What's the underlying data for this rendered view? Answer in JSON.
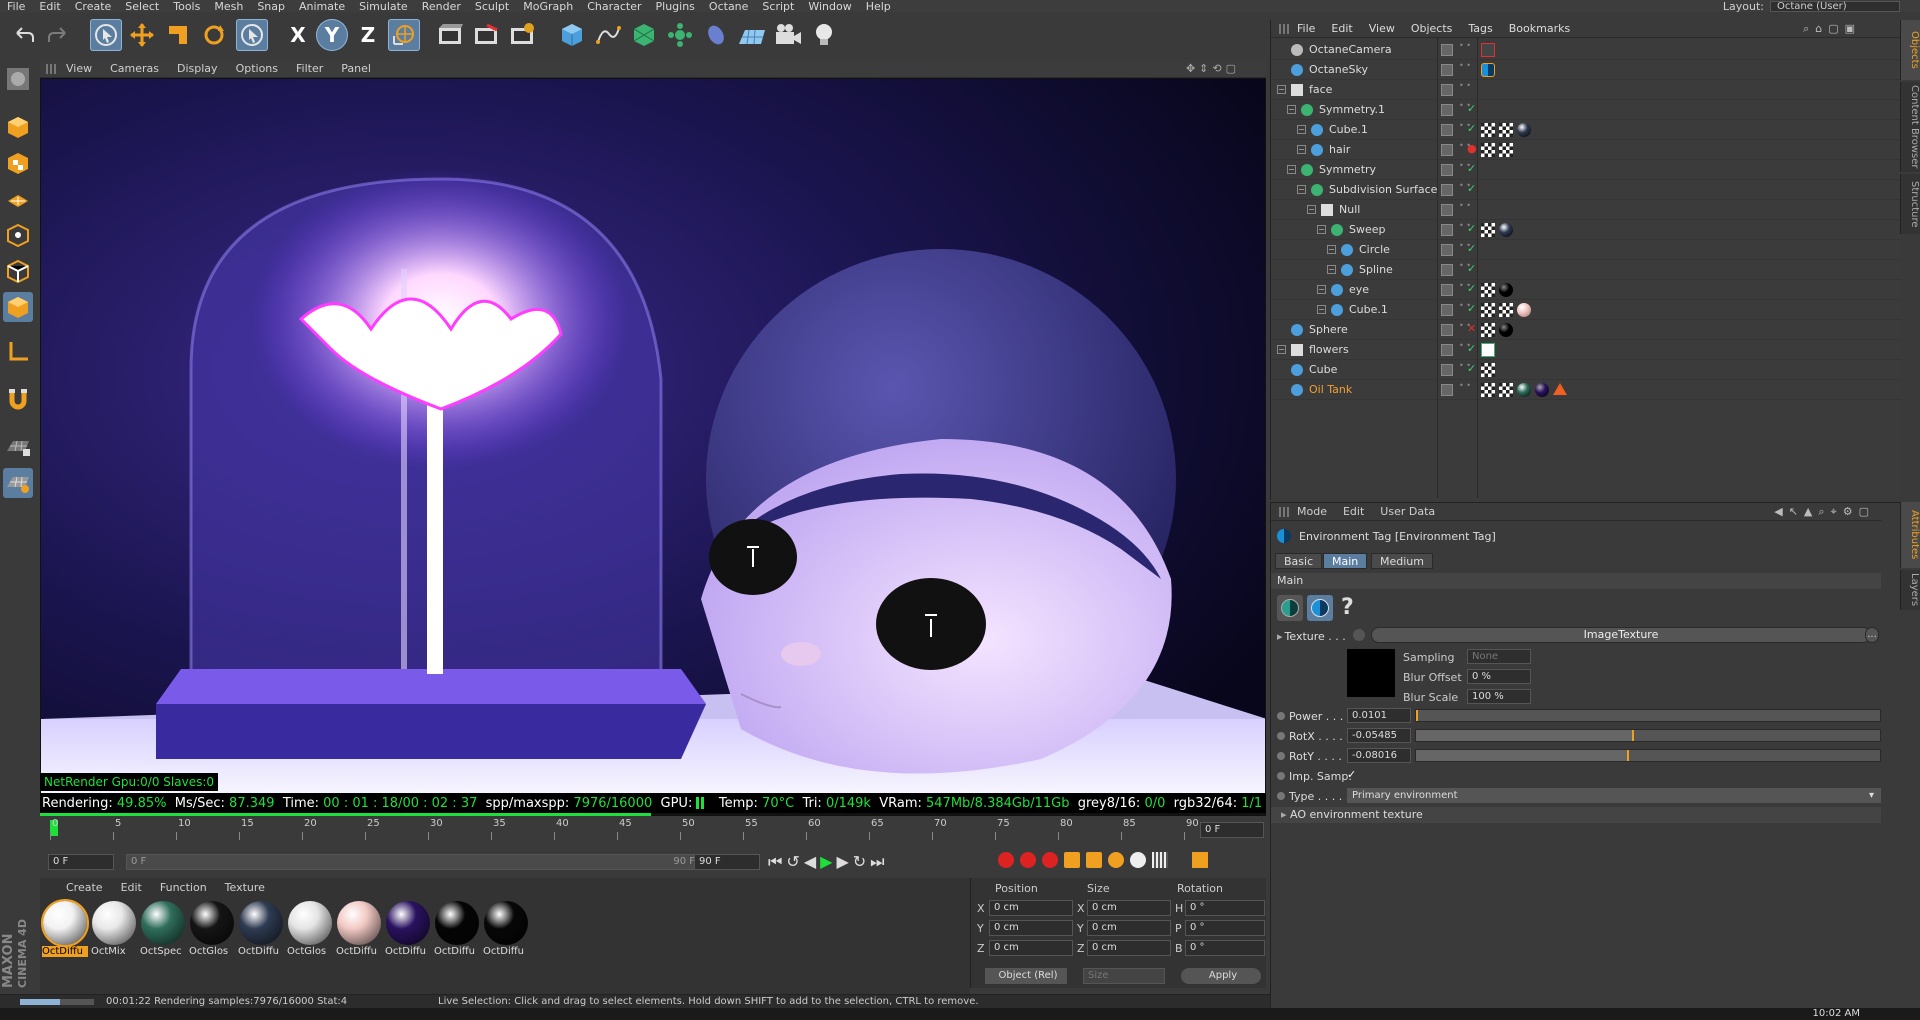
{
  "app": {
    "brand_line1": "MAXON",
    "brand_line2": "CINEMA 4D"
  },
  "menubar": {
    "items": [
      "File",
      "Edit",
      "Create",
      "Select",
      "Tools",
      "Mesh",
      "Snap",
      "Animate",
      "Simulate",
      "Render",
      "Sculpt",
      "MoGraph",
      "Character",
      "Plugins",
      "Octane",
      "Script",
      "Window",
      "Help"
    ],
    "layout_label": "Layout:",
    "layout_value": "Octane (User)"
  },
  "toolbar": {
    "icons": [
      "undo-icon",
      "redo-icon",
      "live-selection-icon",
      "move-icon",
      "scale-icon",
      "rotate-icon",
      "recent-tool-icon",
      "x-axis-icon",
      "y-axis-icon",
      "z-axis-icon",
      "world-coordinates-icon",
      "render-view-icon",
      "render-picture-viewer-icon",
      "render-settings-icon",
      "cube-object-icon",
      "pen-spline-icon",
      "subdivision-icon",
      "array-icon",
      "deformer-icon",
      "floor-icon",
      "camera-icon",
      "light-icon"
    ],
    "axis_x": "X",
    "axis_y": "Y",
    "axis_z": "Z"
  },
  "viewport_menu": {
    "items": [
      "View",
      "Cameras",
      "Display",
      "Options",
      "Filter",
      "Panel"
    ]
  },
  "render_status": {
    "netrender": "NetRender Gpu:0/0 Slaves:0",
    "rendering_label": "Rendering:",
    "rendering_value": "49.85%",
    "ms_label": "Ms/Sec:",
    "ms_value": "87.349",
    "time_label": "Time:",
    "time_value": "00 : 01 : 18/00 : 02 : 37",
    "spp_label": "spp/maxspp:",
    "spp_value": "7976/16000",
    "gpu_label": "GPU:",
    "temp_label": "Temp:",
    "temp_value": "70°C",
    "tri_label": "Tri:",
    "tri_value": "0/149k",
    "vram_label": "VRam:",
    "vram_value": "547Mb/8.384Gb/11Gb",
    "grey_label": "grey8/16:",
    "grey_value": "0/0",
    "rgb_label": "rgb32/64:",
    "rgb_value": "1/1",
    "progress": 0.4985
  },
  "timeline": {
    "ticks": [
      "0",
      "5",
      "10",
      "15",
      "20",
      "25",
      "30",
      "35",
      "40",
      "45",
      "50",
      "55",
      "60",
      "65",
      "70",
      "75",
      "80",
      "85",
      "90"
    ],
    "current_frame": "0 F",
    "start_field": "0 F",
    "range_start": "0 F",
    "range_end": "90 F",
    "end_field": "90 F"
  },
  "material_menu": {
    "items": [
      "Create",
      "Edit",
      "Function",
      "Texture"
    ]
  },
  "materials": [
    {
      "label": "OctDiffu",
      "color": "#f2f2f2",
      "selected": true
    },
    {
      "label": "OctMix",
      "color": "#e8e8e8"
    },
    {
      "label": "OctSpec",
      "color": "#2f6e5c"
    },
    {
      "label": "OctGlos",
      "color": "#151515"
    },
    {
      "label": "OctDiffu",
      "color": "#2f3b52"
    },
    {
      "label": "OctGlos",
      "color": "#e4e4e4"
    },
    {
      "label": "OctDiffu",
      "color": "#f2c9c4"
    },
    {
      "label": "OctDiffu",
      "color": "#2a1260"
    },
    {
      "label": "OctDiffu",
      "color": "#050505"
    },
    {
      "label": "OctDiffu",
      "color": "#070707"
    }
  ],
  "coordinates": {
    "position_label": "Position",
    "size_label": "Size",
    "rotation_label": "Rotation",
    "rows": [
      {
        "axis": "X",
        "pos": "0 cm",
        "size_axis": "X",
        "size": "0 cm",
        "rot_axis": "H",
        "rot": "0 °"
      },
      {
        "axis": "Y",
        "pos": "0 cm",
        "size_axis": "Y",
        "size": "0 cm",
        "rot_axis": "P",
        "rot": "0 °"
      },
      {
        "axis": "Z",
        "pos": "0 cm",
        "size_axis": "Z",
        "size": "0 cm",
        "rot_axis": "B",
        "rot": "0 °"
      }
    ],
    "mode": "Object (Rel)",
    "size_mode": "Size",
    "apply_label": "Apply"
  },
  "statusbar": {
    "time": "00:01:22 Rendering samples:7976/16000 Stat:4",
    "hint": "Live Selection: Click and drag to select elements. Hold down SHIFT to add to the selection, CTRL to remove."
  },
  "objects_menu": {
    "items": [
      "File",
      "Edit",
      "View",
      "Objects",
      "Tags",
      "Bookmarks"
    ]
  },
  "objects": [
    {
      "name": "OctaneCamera",
      "indent": 0,
      "icon": "camera-icon",
      "color": "#dcdcdc"
    },
    {
      "name": "OctaneSky",
      "indent": 0,
      "icon": "sky-icon",
      "color": "#dcdcdc"
    },
    {
      "name": "face",
      "indent": 0,
      "icon": "null-icon",
      "color": "#dcdcdc"
    },
    {
      "name": "Symmetry.1",
      "indent": 1,
      "icon": "symmetry-icon",
      "color": "#dcdcdc"
    },
    {
      "name": "Cube.1",
      "indent": 2,
      "icon": "polygon-icon",
      "color": "#dcdcdc"
    },
    {
      "name": "hair",
      "indent": 2,
      "icon": "polygon-icon",
      "color": "#dcdcdc"
    },
    {
      "name": "Symmetry",
      "indent": 1,
      "icon": "symmetry-icon",
      "color": "#dcdcdc"
    },
    {
      "name": "Subdivision Surface",
      "indent": 2,
      "icon": "subdivision-icon",
      "color": "#dcdcdc"
    },
    {
      "name": "Null",
      "indent": 3,
      "icon": "null-icon",
      "color": "#dcdcdc"
    },
    {
      "name": "Sweep",
      "indent": 4,
      "icon": "sweep-icon",
      "color": "#dcdcdc"
    },
    {
      "name": "Circle",
      "indent": 5,
      "icon": "circle-spline-icon",
      "color": "#dcdcdc"
    },
    {
      "name": "Spline",
      "indent": 5,
      "icon": "spline-icon",
      "color": "#dcdcdc"
    },
    {
      "name": "eye",
      "indent": 4,
      "icon": "sphere-icon",
      "color": "#dcdcdc"
    },
    {
      "name": "Cube.1",
      "indent": 4,
      "icon": "polygon-icon",
      "color": "#dcdcdc"
    },
    {
      "name": "Sphere",
      "indent": 0,
      "icon": "sphere-icon",
      "color": "#dcdcdc"
    },
    {
      "name": "flowers",
      "indent": 0,
      "icon": "null-icon",
      "color": "#dcdcdc"
    },
    {
      "name": "Cube",
      "indent": 0,
      "icon": "cube-icon",
      "color": "#dcdcdc"
    },
    {
      "name": "Oil Tank",
      "indent": 0,
      "icon": "polygon-icon",
      "color": "#f0a030"
    }
  ],
  "attributes_menu": {
    "items": [
      "Mode",
      "Edit",
      "User Data"
    ]
  },
  "attributes": {
    "title": "Environment Tag [Environment Tag]",
    "tabs": [
      "Basic",
      "Main",
      "Medium"
    ],
    "active_tab": "Main",
    "section": "Main",
    "texture_label": "Texture . . .",
    "texture_value": "ImageTexture",
    "texture_more": "...",
    "sampling_label": "Sampling",
    "sampling_value": "None",
    "blur_offset_label": "Blur Offset",
    "blur_offset_value": "0 %",
    "blur_scale_label": "Blur Scale",
    "blur_scale_value": "100 %",
    "power_label": "Power . . . .",
    "power_value": "0.0101",
    "power_fill": 0.0,
    "rotx_label": "RotX . . . .",
    "rotx_value": "-0.05485",
    "rotx_fill": 0.47,
    "roty_label": "RotY . . . .",
    "roty_value": "-0.08016",
    "roty_fill": 0.46,
    "imp_label": "Imp. Samp.",
    "imp_check": "✓",
    "type_label": "Type . . . . .",
    "type_value": "Primary environment",
    "ao_label": "AO environment texture"
  },
  "side_tabs": {
    "objects": "Objects",
    "content": "Content Browser",
    "structure": "Structure",
    "attributes": "Attributes",
    "layers": "Layers"
  },
  "clock": "10:02 AM"
}
